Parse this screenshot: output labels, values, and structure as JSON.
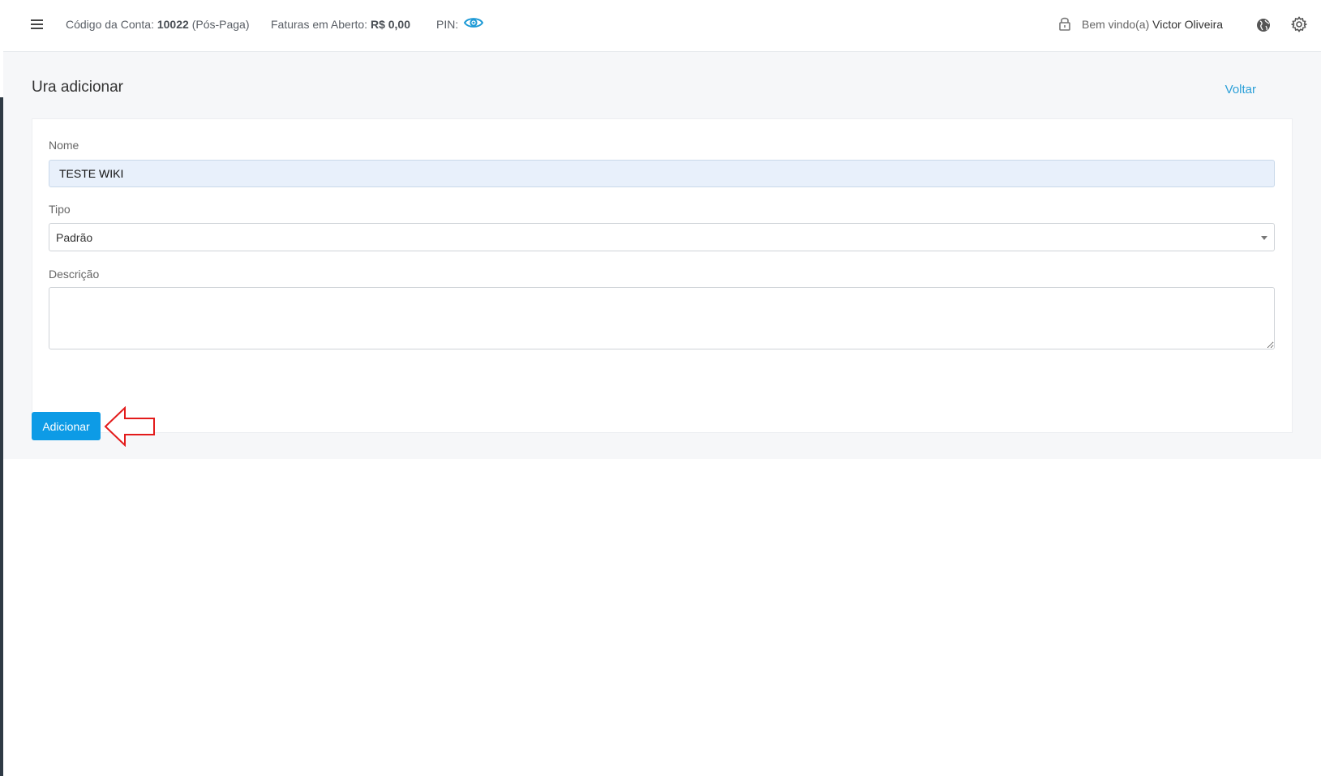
{
  "topbar": {
    "account_label": "Código da Conta:",
    "account_code": "10022",
    "account_type": "(Pós-Paga)",
    "invoices_label": "Faturas em Aberto:",
    "invoices_value": "R$ 0,00",
    "pin_label": "PIN:",
    "welcome_label": "Bem vindo(a)",
    "user_name": "Victor Oliveira"
  },
  "page": {
    "title": "Ura adicionar",
    "back_label": "Voltar"
  },
  "form": {
    "nome_label": "Nome",
    "nome_value": "TESTE WIKI",
    "tipo_label": "Tipo",
    "tipo_value": "Padrão",
    "descricao_label": "Descrição",
    "descricao_value": "",
    "submit_label": "Adicionar"
  },
  "icons": {
    "menu": "hamburger-menu-icon",
    "pin": "eye-icon",
    "lock": "lock-icon",
    "globe": "globe-icon",
    "settings": "gear-icon",
    "annotation": "arrow-left-icon"
  },
  "colors": {
    "accent": "#0d9be6",
    "link": "#2a9fd8",
    "annotation": "#e31b1b",
    "input_filled_bg": "#e8f0fb"
  }
}
